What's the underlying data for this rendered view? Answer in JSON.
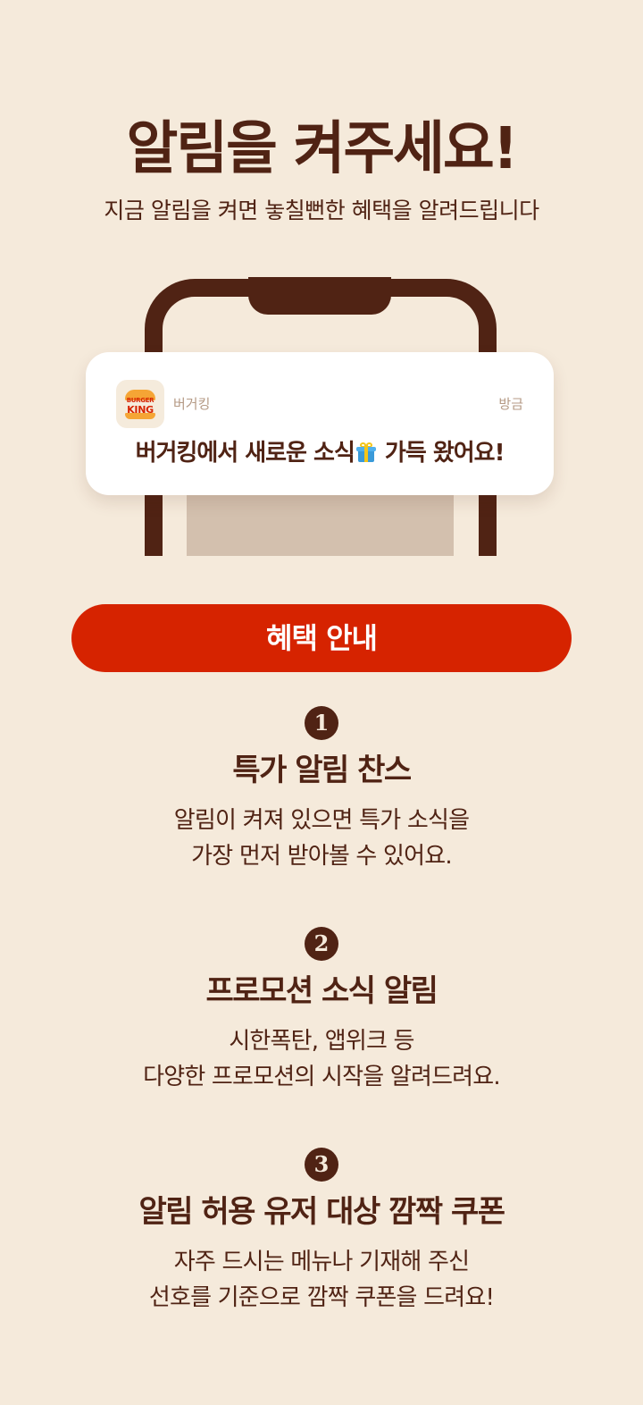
{
  "header": {
    "title": "알림을 켜주세요!",
    "subtitle": "지금 알림을 켜면 놓칠뻔한 혜택을 알려드립니다"
  },
  "notification": {
    "logo_top": "BURGER",
    "logo_bottom": "KING",
    "app_name": "버거킹",
    "time": "방금",
    "message_before": "버거킹에서 새로운 소식",
    "message_after": " 가득 왔어요!",
    "icon": "gift-icon"
  },
  "benefits_button": {
    "label": "혜택 안내"
  },
  "benefits": [
    {
      "number": "1",
      "title": "특가 알림 찬스",
      "lines": [
        "알림이 켜져 있으면 특가 소식을",
        "가장 먼저 받아볼 수 있어요."
      ]
    },
    {
      "number": "2",
      "title": "프로모션 소식 알림",
      "lines": [
        "시한폭탄, 앱위크 등",
        "다양한 프로모션의 시작을 알려드려요."
      ]
    },
    {
      "number": "3",
      "title": "알림 허용 유저 대상 깜짝 쿠폰",
      "lines": [
        "자주 드시는 메뉴나 기재해 주신",
        "선호를 기준으로 깜짝 쿠폰을 드려요!"
      ]
    }
  ],
  "colors": {
    "background": "#f5eadb",
    "brown": "#502314",
    "accent_red": "#d62300",
    "card": "#ffffff",
    "muted": "#b59a85"
  }
}
